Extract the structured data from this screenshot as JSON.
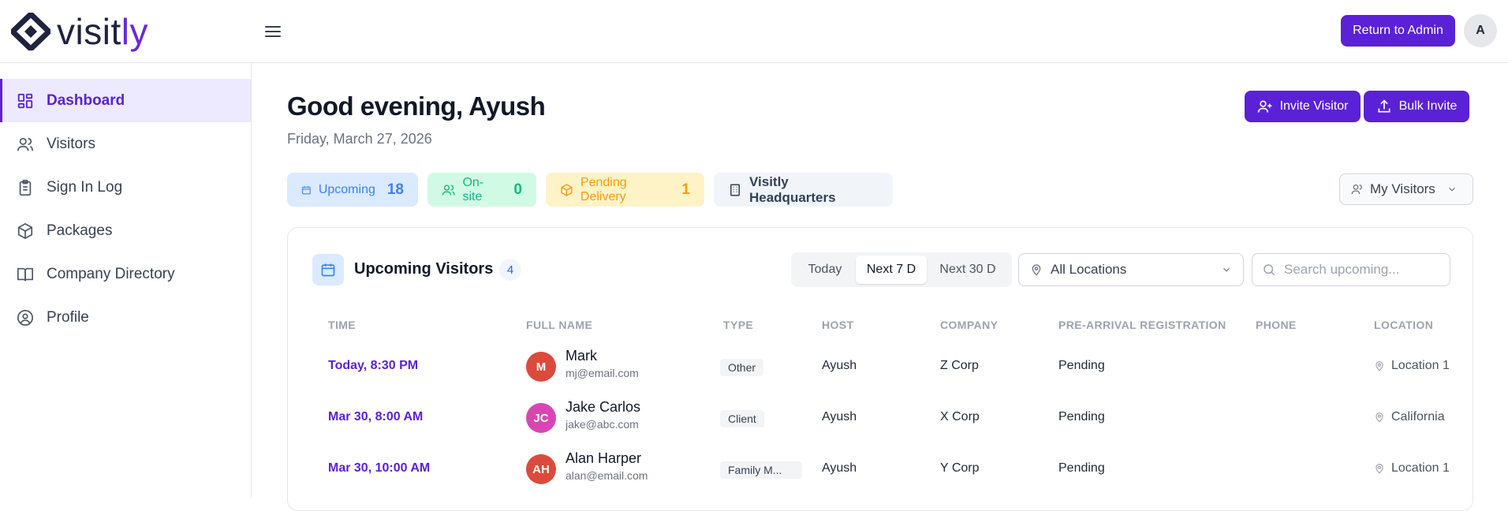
{
  "topbar": {
    "logo_prefix": "visit",
    "logo_suffix": "ly",
    "return_admin_label": "Return to Admin",
    "user_initial": "A"
  },
  "sidebar": {
    "items": [
      {
        "label": "Dashboard",
        "icon": "dashboard-icon",
        "active": true
      },
      {
        "label": "Visitors",
        "icon": "users-icon"
      },
      {
        "label": "Sign In Log",
        "icon": "clipboard-icon"
      },
      {
        "label": "Packages",
        "icon": "package-icon"
      },
      {
        "label": "Company Directory",
        "icon": "book-icon"
      },
      {
        "label": "Profile",
        "icon": "user-circle-icon"
      }
    ]
  },
  "header": {
    "greeting": "Good evening, Ayush",
    "date": "Friday, March 27, 2026",
    "invite_label": "Invite Visitor",
    "bulk_label": "Bulk Invite"
  },
  "stats": {
    "upcoming_label": "Upcoming",
    "upcoming_count": "18",
    "onsite_label": "On-site",
    "onsite_count": "0",
    "pending_label": "Pending Delivery",
    "pending_count": "1",
    "location_label": "Visitly Headquarters"
  },
  "filter": {
    "my_visitors": "My Visitors"
  },
  "card": {
    "title": "Upcoming Visitors",
    "count": "4",
    "ranges": [
      "Today",
      "Next 7 D",
      "Next 30 D"
    ],
    "selected_range": "Next 7 D",
    "location_select": "All Locations",
    "search_placeholder": "Search upcoming..."
  },
  "table": {
    "headers": [
      "TIME",
      "FULL NAME",
      "TYPE",
      "HOST",
      "COMPANY",
      "PRE-ARRIVAL REGISTRATION",
      "PHONE",
      "LOCATION"
    ],
    "rows": [
      {
        "time": "Today, 8:30 PM",
        "initials": "M",
        "avatar_color": "#dc4a3d",
        "name": "Mark",
        "email": "mj@email.com",
        "type": "Other",
        "host": "Ayush",
        "company": "Z Corp",
        "registration": "Pending",
        "phone": "",
        "location": "Location 1"
      },
      {
        "time": "Mar 30, 8:00 AM",
        "initials": "JC",
        "avatar_color": "#d946b4",
        "name": "Jake Carlos",
        "email": "jake@abc.com",
        "type": "Client",
        "host": "Ayush",
        "company": "X Corp",
        "registration": "Pending",
        "phone": "",
        "location": "California"
      },
      {
        "time": "Mar 30, 10:00 AM",
        "initials": "AH",
        "avatar_color": "#dc4a3d",
        "name": "Alan Harper",
        "email": "alan@email.com",
        "type": "Family M...",
        "host": "Ayush",
        "company": "Y Corp",
        "registration": "Pending",
        "phone": "",
        "location": "Location 1"
      }
    ]
  },
  "colors": {
    "accent": "#5b21d6",
    "upcoming_bg": "#dbeafe",
    "upcoming_fg": "#3b82f6",
    "onsite_bg": "#d1fae5",
    "onsite_fg": "#10b981",
    "pending_bg": "#fef3c7",
    "pending_fg": "#f59e0b"
  }
}
